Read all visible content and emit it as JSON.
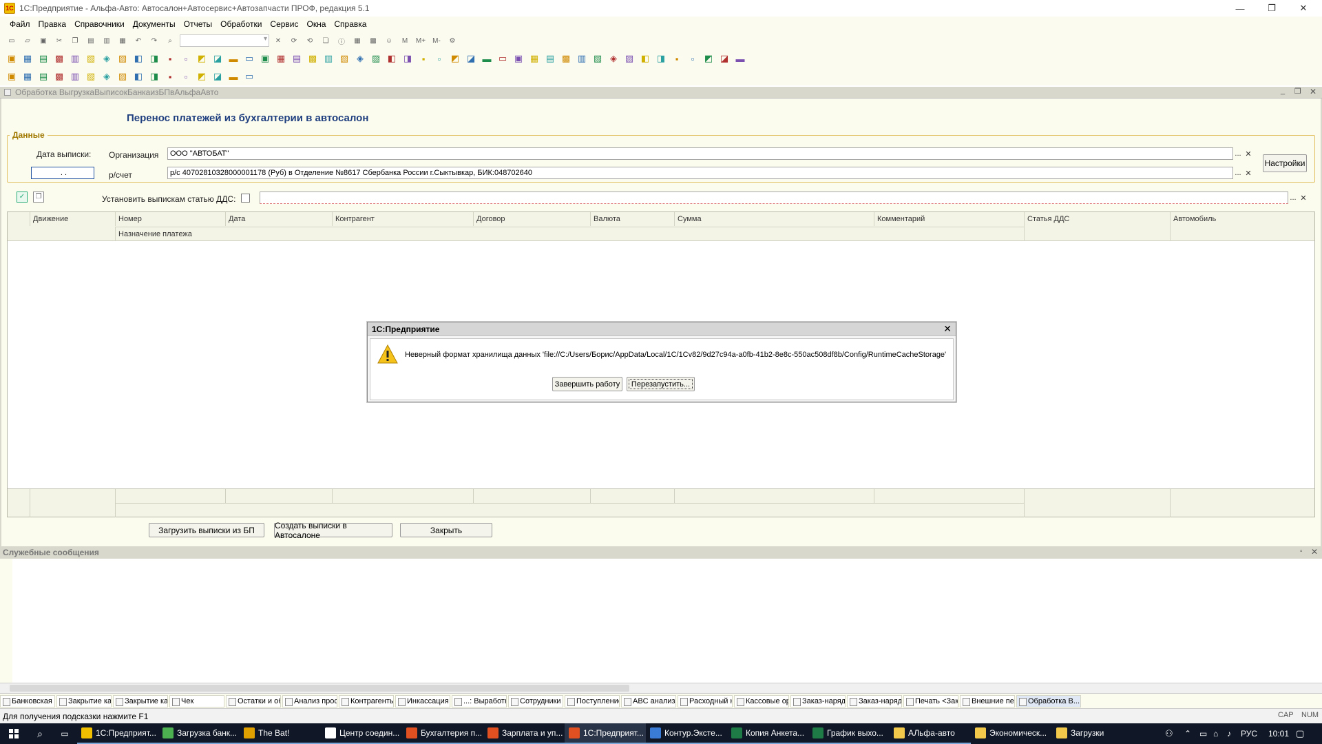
{
  "window": {
    "title": "1С:Предприятие - Альфа-Авто: Автосалон+Автосервис+Автозапчасти ПРОФ, редакция 5.1",
    "minimize": "—",
    "restore": "❐",
    "close": "✕"
  },
  "menu": [
    "Файл",
    "Правка",
    "Справочники",
    "Документы",
    "Отчеты",
    "Обработки",
    "Сервис",
    "Окна",
    "Справка"
  ],
  "toolbar": {
    "memory_buttons": [
      "M",
      "M+",
      "M-"
    ]
  },
  "subwindow": {
    "title": "Обработка   ВыгрузкаВыписокБанкаизБПвАльфаАвто",
    "controls": [
      "_",
      "❐",
      "✕"
    ]
  },
  "form": {
    "heading": "Перенос платежей из бухгалтерии в автосалон",
    "group_title": "Данные",
    "date_label": "Дата выписки:",
    "date_value": "  .  .  ",
    "org_label": "Организация",
    "org_value": "ООО \"АВТОБАТ\"",
    "account_label": "р/счет",
    "account_value": "р/с 40702810328000001178 (Руб) в Отделение №8617 Сбербанка России г.Сыктывкар, БИК:048702640",
    "settings_button": "Настройки",
    "dds_label": "Установить выпискам статью ДДС:",
    "dds_value": "",
    "select_button": "...",
    "clear_button": "✕"
  },
  "table": {
    "columns": [
      "Движение",
      "Номер",
      "Дата",
      "Контрагент",
      "Договор",
      "Валюта",
      "Сумма",
      "Комментарий",
      "Статья ДДС",
      "Автомобиль"
    ],
    "subheader": "Назначение платежа"
  },
  "buttons": {
    "load": "Загрузить выписки из БП",
    "create": "Создать выписки в Автосалоне",
    "close": "Закрыть"
  },
  "dialog": {
    "title": "1С:Предприятие",
    "message": "Неверный формат хранилища данных 'file://C:/Users/Борис/AppData/Local/1C/1Cv82/9d27c94a-a0fb-41b2-8e8c-550ac508df8b/Config/RuntimeCacheStorage'",
    "btn_finish": "Завершить работу",
    "btn_restart": "Перезапустить...",
    "close": "✕"
  },
  "service": {
    "title": "Служебные сообщения",
    "pin": "▫",
    "close": "✕"
  },
  "window_tabs": [
    "Банковская ...",
    "Закрытие ка...",
    "Закрытие ка...",
    "Чек",
    "Остатки и об...",
    "Анализ прос...",
    "Контрагенты...",
    "Инкассация",
    "...: Выработк...",
    "Сотрудники",
    "Поступление...",
    "ABC анализ ...",
    "Расходный к...",
    "Кассовые ор...",
    "Заказ-наряд",
    "Заказ-наряд ...",
    "Печать <Зак...",
    "Внешние печ...",
    "Обработка  В..."
  ],
  "status": {
    "hint": "Для получения подсказки нажмите F1",
    "cap": "CAP",
    "num": "NUM"
  },
  "taskbar": {
    "items": [
      {
        "label": "1С:Предприят...",
        "color": "#f0c000"
      },
      {
        "label": "Загрузка банк...",
        "color": "#4caf50"
      },
      {
        "label": "The Bat!",
        "color": "#e0a000"
      },
      {
        "label": "Центр соедин...",
        "color": "#ffffff"
      },
      {
        "label": "Бухгалтерия п...",
        "color": "#e05020"
      },
      {
        "label": "Зарплата и уп...",
        "color": "#e05020"
      },
      {
        "label": "1С:Предприят...",
        "color": "#e05020"
      },
      {
        "label": "Контур.Эксте...",
        "color": "#3a7bd5"
      },
      {
        "label": "Копия Анкета...",
        "color": "#1e7b45"
      },
      {
        "label": "График выхо...",
        "color": "#1e7b45"
      },
      {
        "label": "АЛьфа-авто",
        "color": "#f3c94b"
      },
      {
        "label": "Экономическ...",
        "color": "#f3c94b"
      },
      {
        "label": "Загрузки",
        "color": "#f3c94b"
      }
    ],
    "lang": "РУС",
    "time": "10:01"
  }
}
